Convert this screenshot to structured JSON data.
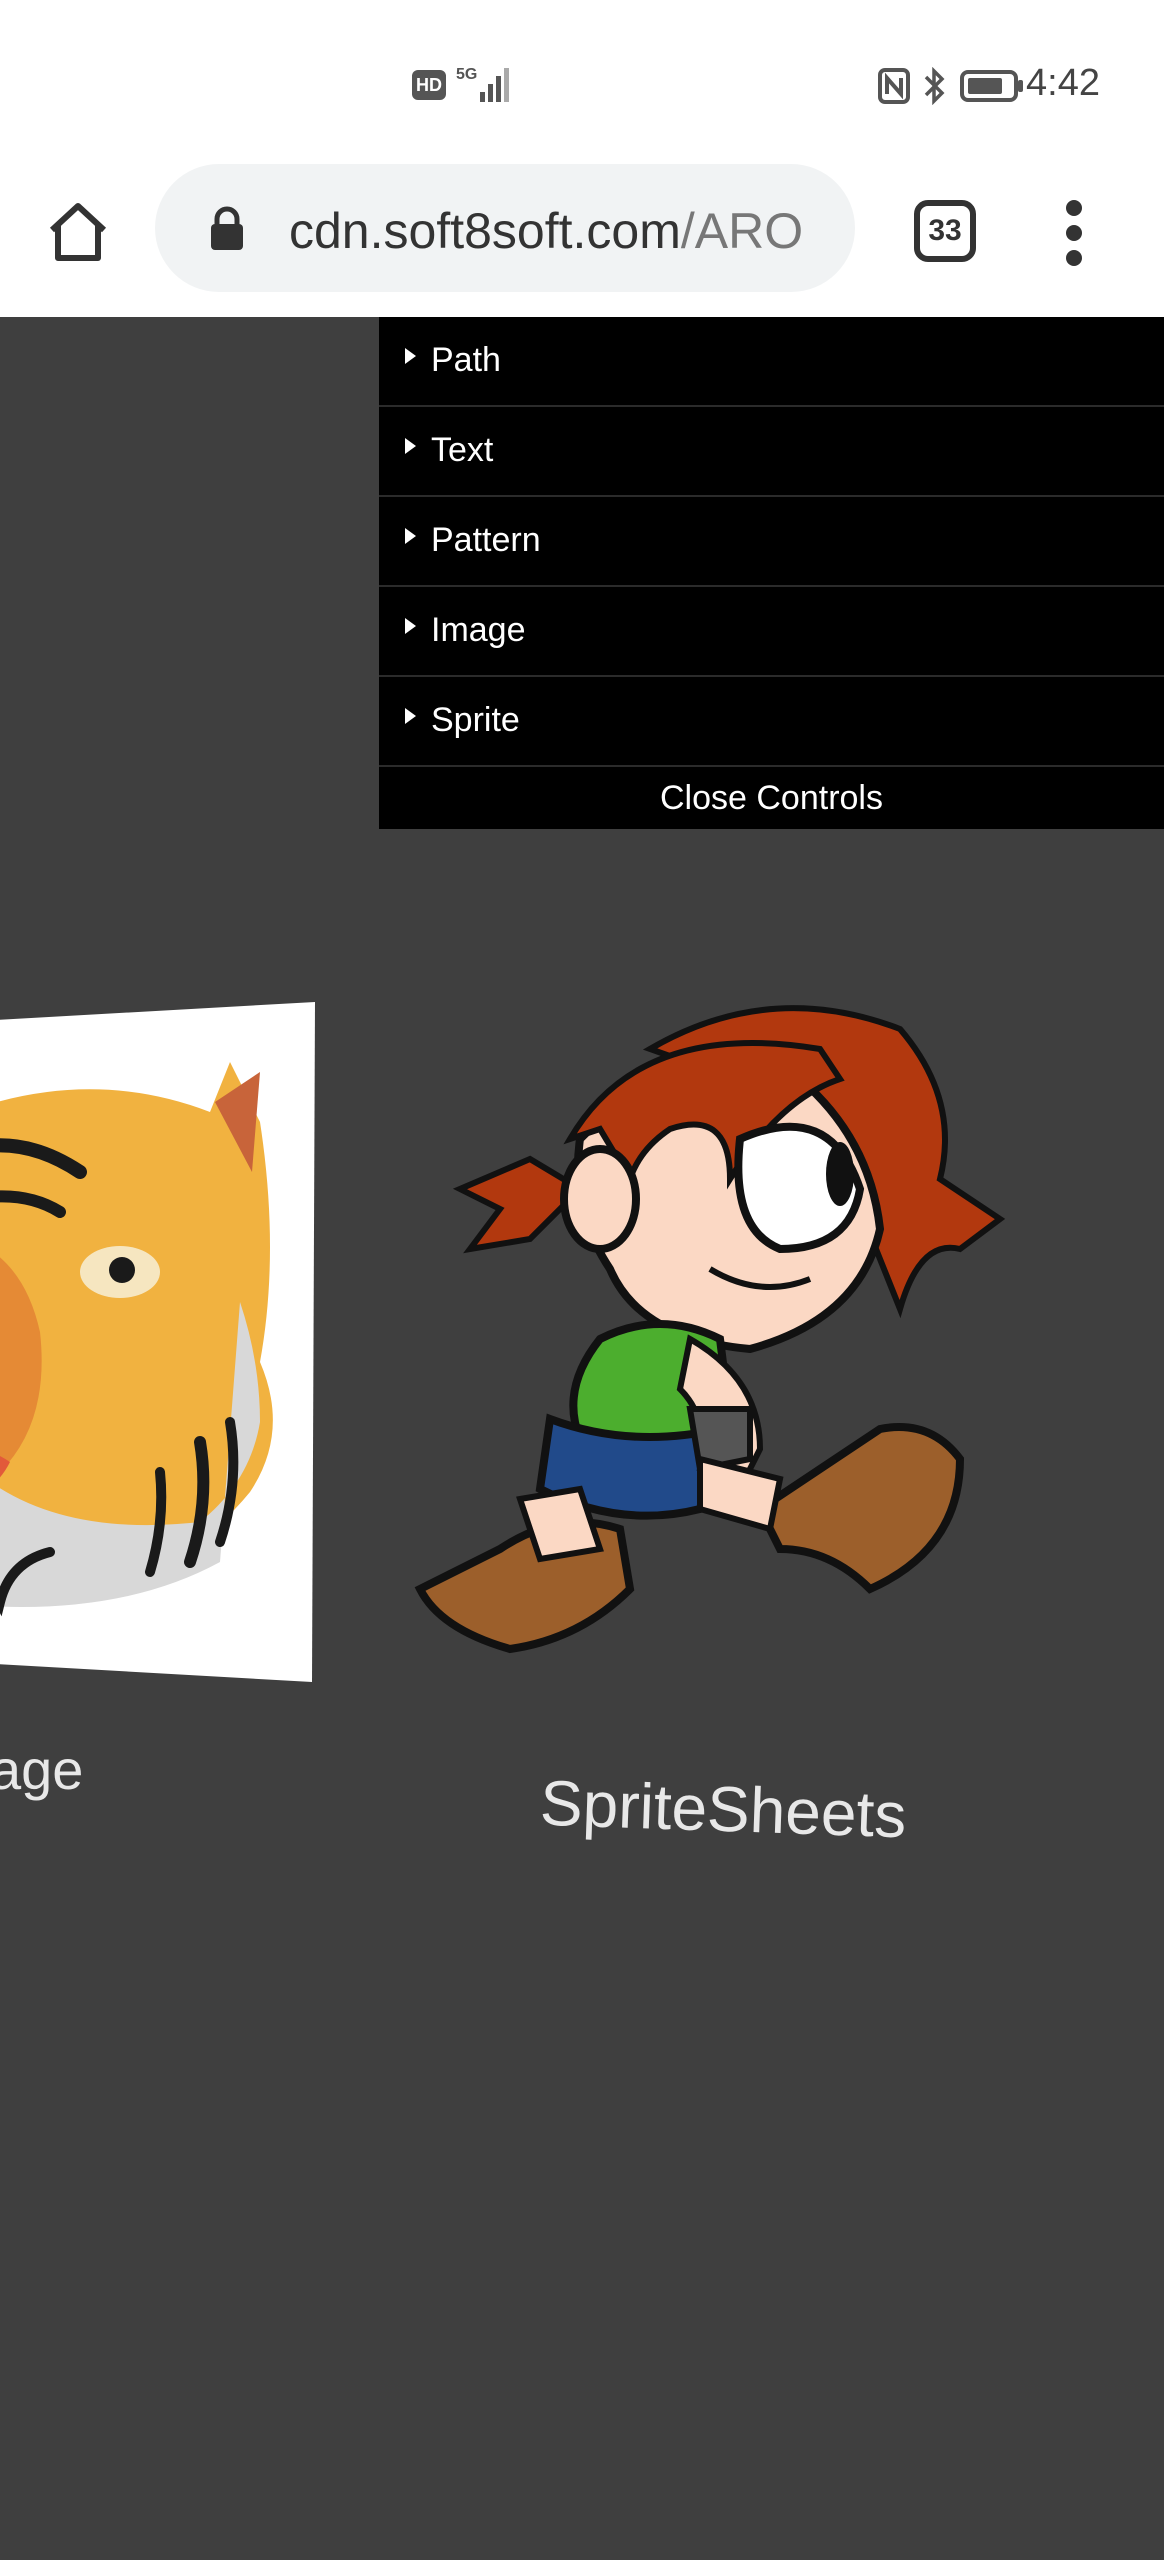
{
  "status_bar": {
    "hd": "HD",
    "network": "5G",
    "time": "4:42",
    "icons": [
      "nfc-icon",
      "bluetooth-icon",
      "battery-icon"
    ]
  },
  "browser": {
    "url_main": "cdn.soft8soft.com",
    "url_path": "/ARO",
    "tab_count": "33"
  },
  "controls": {
    "items": [
      {
        "label": "Path"
      },
      {
        "label": "Text"
      },
      {
        "label": "Pattern"
      },
      {
        "label": "Image"
      },
      {
        "label": "Sprite"
      }
    ],
    "close_label": "Close Controls"
  },
  "scene": {
    "image_caption": "age",
    "sprite_caption": "SpriteSheets"
  }
}
